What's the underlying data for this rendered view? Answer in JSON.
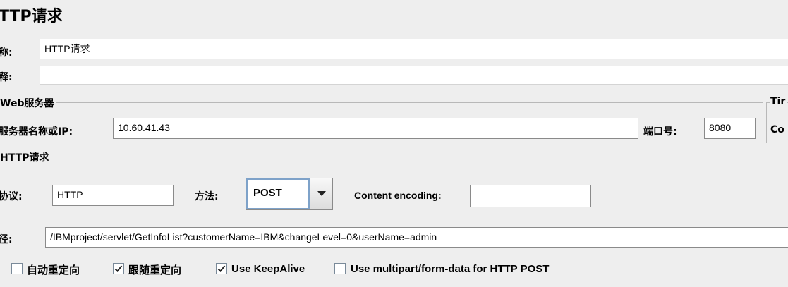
{
  "page_title": "TTP请求",
  "name": {
    "label": "称:",
    "value": "HTTP请求"
  },
  "comment": {
    "label": "释:",
    "value": ""
  },
  "web_server": {
    "group_title": "Web服务器",
    "server_label": "服务器名称或IP:",
    "server_value": "10.60.41.43",
    "port_label": "端口号:",
    "port_value": "8080",
    "timeout_group_title": "Tir",
    "timeout_connect_label": "Co"
  },
  "http_request": {
    "group_title": "HTTP请求",
    "protocol_label": "协议:",
    "protocol_value": "HTTP",
    "method_label": "方法:",
    "method_value": "POST",
    "encoding_label": "Content encoding:",
    "encoding_value": "",
    "path_label": "径:",
    "path_value": "/IBMproject/servlet/GetInfoList?customerName=IBM&changeLevel=0&userName=admin"
  },
  "options": [
    {
      "label": "自动重定向",
      "checked": false
    },
    {
      "label": "跟随重定向",
      "checked": true
    },
    {
      "label": "Use KeepAlive",
      "checked": true
    },
    {
      "label": "Use multipart/form-data for HTTP POST",
      "checked": false
    }
  ]
}
